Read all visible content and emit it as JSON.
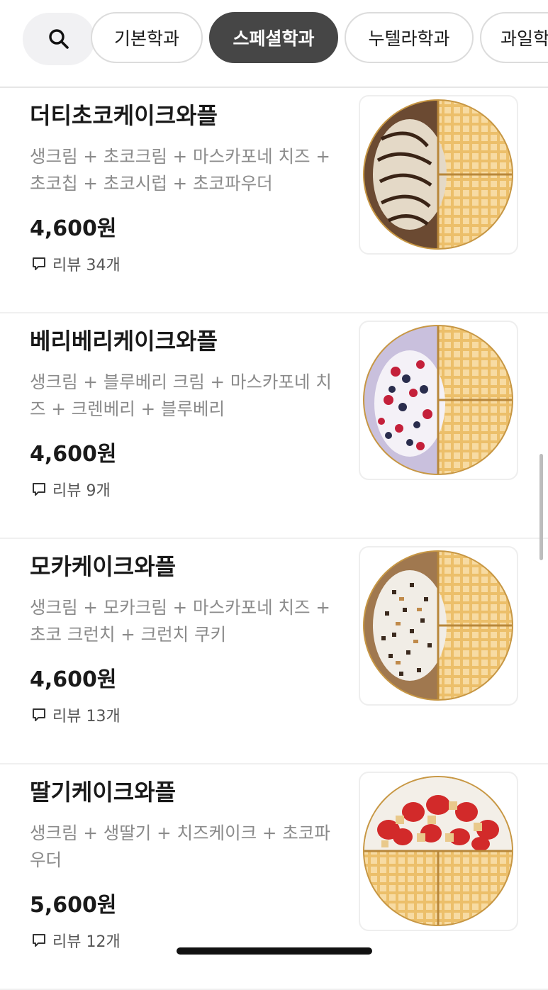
{
  "categories": {
    "search_icon": "search-icon",
    "chips": [
      "기본학과",
      "스페셜학과",
      "누텔라학과",
      "과일학"
    ],
    "active_index": 1
  },
  "menu": [
    {
      "name": "더티초코케이크와플",
      "desc": "생크림 + 초코크림 + 마스카포네 치즈 + 초코칩 + 초코시럽 + 초코파우더",
      "price": "4,600원",
      "review": "리뷰 34개",
      "image": "dirty-choco-waffle-image"
    },
    {
      "name": "베리베리케이크와플",
      "desc": "생크림 + 블루베리 크림 + 마스카포네 치즈 + 크렌베리 + 블루베리",
      "price": "4,600원",
      "review": "리뷰 9개",
      "image": "berry-berry-waffle-image"
    },
    {
      "name": "모카케이크와플",
      "desc": "생크림 + 모카크림 + 마스카포네 치즈 + 초코 크런치 + 크런치 쿠키",
      "price": "4,600원",
      "review": "리뷰 13개",
      "image": "mocha-waffle-image"
    },
    {
      "name": "딸기케이크와플",
      "desc": "생크림 + 생딸기 + 치즈케이크 + 초코파우더",
      "price": "5,600원",
      "review": "리뷰 12개",
      "image": "strawberry-waffle-image"
    }
  ],
  "colors": {
    "active_chip": "#464646",
    "chip_border": "#dcdcdc",
    "desc_text": "#8a8a8a",
    "waffle": "#ecbf6a",
    "chocolate": "#5a3a25"
  }
}
